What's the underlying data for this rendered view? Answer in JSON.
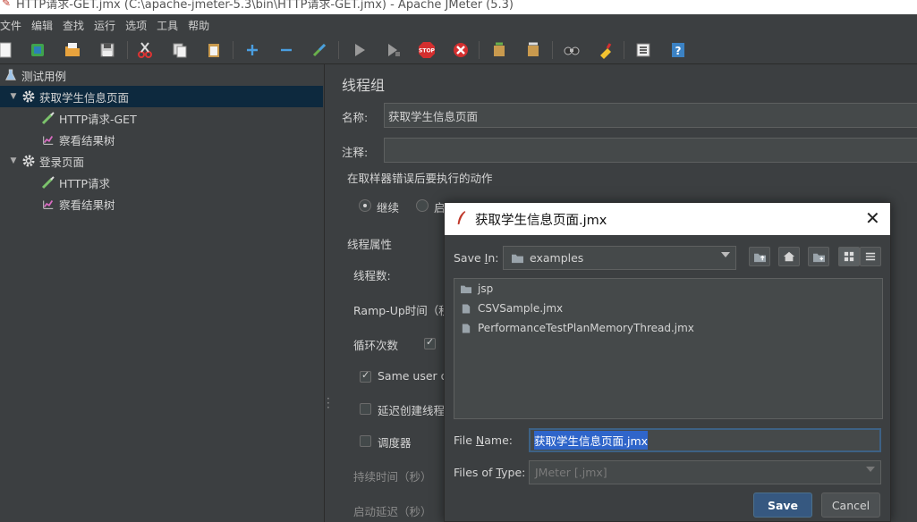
{
  "window": {
    "title": "HTTP请求-GET.jmx (C:\\apache-jmeter-5.3\\bin\\HTTP请求-GET.jmx) - Apache JMeter (5.3)"
  },
  "menu": [
    "文件",
    "编辑",
    "查找",
    "运行",
    "选项",
    "工具",
    "帮助"
  ],
  "toolbar": {
    "icons": [
      "new-icon",
      "templates-icon",
      "open-icon",
      "save-icon",
      "cut-icon",
      "copy-icon",
      "paste-icon",
      "expand-icon",
      "collapse-icon",
      "toggle-icon",
      "start-icon",
      "start-no-pause-icon",
      "stop-icon",
      "shutdown-icon",
      "clear-icon",
      "clear-all-icon",
      "search-icon",
      "reset-search-icon",
      "function-helper-icon",
      "help-icon"
    ]
  },
  "tree": {
    "root": "测试用例",
    "group1": "获取学生信息页面",
    "g1_http": "HTTP请求-GET",
    "g1_view": "察看结果树",
    "group2": "登录页面",
    "g2_http": "HTTP请求",
    "g2_view": "察看结果树"
  },
  "panel": {
    "title": "线程组",
    "name_label": "名称:",
    "name_value": "获取学生信息页面",
    "comment_label": "注释:",
    "comment_value": "",
    "error_action_label": "在取样器错误后要执行的动作",
    "continue_label": "继续",
    "start_next_partial": "启",
    "thread_props_label": "线程属性",
    "thread_count_label": "线程数:",
    "rampup_label": "Ramp-Up时间（秒",
    "loop_label": "循环次数",
    "same_user_label": "Same user or",
    "delay_create_label": "延迟创建线程",
    "scheduler_label": "调度器",
    "duration_label": "持续时间（秒）",
    "startup_delay_label": "启动延迟（秒）"
  },
  "dialog": {
    "title": "获取学生信息页面.jmx",
    "save_in_label": "Save In:",
    "save_in_underline": "I",
    "save_in_value": "examples",
    "files": [
      {
        "name": "jsp",
        "type": "folder"
      },
      {
        "name": "CSVSample.jmx",
        "type": "file"
      },
      {
        "name": "PerformanceTestPlanMemoryThread.jmx",
        "type": "file"
      }
    ],
    "file_name_label": "File Name:",
    "file_name_value": "获取学生信息页面.jmx",
    "files_of_type_label": "Files of Type:",
    "files_of_type_value": "JMeter [.jmx]",
    "save_button": "Save",
    "cancel_button": "Cancel"
  }
}
